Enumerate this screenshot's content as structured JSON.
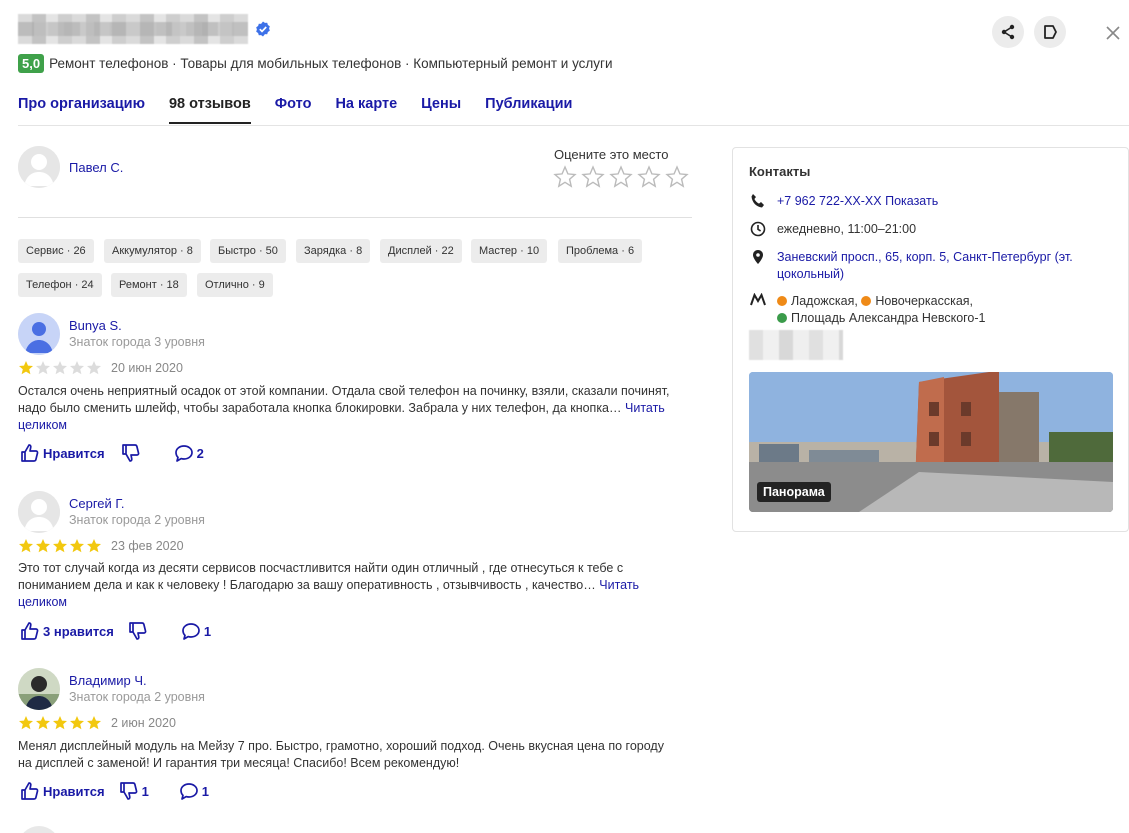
{
  "header": {
    "rating": "5,0",
    "categories": "Ремонт телефонов · Товары для мобильных телефонов · Компьютерный ремонт и услуги"
  },
  "tabs": [
    {
      "label": "Про организацию"
    },
    {
      "label": "98 отзывов"
    },
    {
      "label": "Фото"
    },
    {
      "label": "На карте"
    },
    {
      "label": "Цены"
    },
    {
      "label": "Публикации"
    }
  ],
  "my_review": {
    "user": "Павел С.",
    "rate_title": "Оцените это место"
  },
  "chips": [
    "Сервис · 26",
    "Аккумулятор · 8",
    "Быстро · 50",
    "Зарядка · 8",
    "Дисплей · 22",
    "Мастер · 10",
    "Проблема · 6",
    "Телефон · 24",
    "Ремонт · 18",
    "Отлично · 9"
  ],
  "reviews": [
    {
      "name": "Bunya S.",
      "level": "Знаток города 3 уровня",
      "stars": 1,
      "date": "20 июн 2020",
      "text": "Остался очень неприятный осадок от этой компании. Отдала свой телефон на починку, взяли, сказали починят, надо было сменить шлейф, чтобы заработала кнопка блокировки. Забрала у них телефон, да кнопка…",
      "read_more": "Читать целиком",
      "like": "Нравится",
      "dislike": "",
      "comments": "2"
    },
    {
      "name": "Сергей Г.",
      "level": "Знаток города 2 уровня",
      "stars": 5,
      "date": "23 фев 2020",
      "text": "Это тот случай когда из десяти сервисов посчастливится найти один отличный , где отнесуться к тебе с пониманием дела и как к человеку ! Благодарю за вашу оперативность , отзывчивость , качество…",
      "read_more": "Читать целиком",
      "like": "3 нравится",
      "dislike": "",
      "comments": "1"
    },
    {
      "name": "Владимир Ч.",
      "level": "Знаток города 2 уровня",
      "stars": 5,
      "date": "2 июн 2020",
      "text": "Менял дисплейный модуль на Мейзу 7 про. Быстро, грамотно, хороший подход. Очень вкусная цена по городу на дисплей с заменой! И гарантия три месяца! Спасибо! Всем рекомендую!",
      "read_more": "",
      "like": "Нравится",
      "dislike": "1",
      "comments": "1"
    }
  ],
  "contacts": {
    "title": "Контакты",
    "phone": "+7 962 722-XX-XX",
    "phone_show": "Показать",
    "hours": "ежедневно, 11:00–21:00",
    "address": "Заневский просп., 65, корп. 5, Санкт-Петербург (эт. цокольный)",
    "metro": [
      {
        "name": "Ладожская",
        "color": "#ef8a17"
      },
      {
        "name": "Новочеркасская",
        "color": "#ef8a17"
      },
      {
        "name": "Площадь Александра Невского-1",
        "color": "#3b9b4a"
      }
    ],
    "panorama_label": "Панорама"
  },
  "colors": {
    "link": "#1a1aa6",
    "star": "#f2c80f",
    "rating_badge": "#3fa14a"
  }
}
